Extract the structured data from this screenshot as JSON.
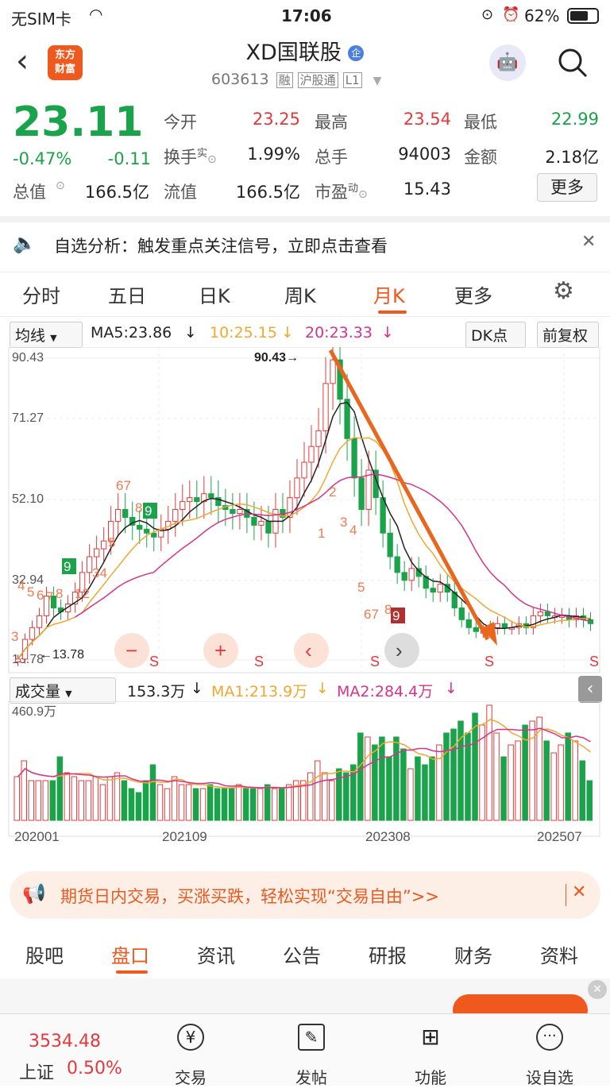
{
  "status": {
    "carrier": "无SIM卡",
    "time": "17:06",
    "battery": "62%"
  },
  "header": {
    "brand_line1": "东方",
    "brand_line2": "财富",
    "title": "XD国联股",
    "badge": "企",
    "code": "603613",
    "tag_margin": "融",
    "tag_connect": "沪股通",
    "tag_level": "L1"
  },
  "quote": {
    "price": "23.11",
    "change_pct": "-0.47%",
    "change": "-0.11",
    "open_label": "今开",
    "open": "23.25",
    "high_label": "最高",
    "high": "23.54",
    "low_label": "最低",
    "low": "22.99",
    "turnover_label": "换手",
    "turnover_sup": "实",
    "turnover": "1.99%",
    "volume_label": "总手",
    "volume": "94003",
    "amount_label": "金额",
    "amount": "2.18亿",
    "mktcap_label": "总值",
    "mktcap": "166.5亿",
    "float_label": "流值",
    "float": "166.5亿",
    "pe_label": "市盈",
    "pe_sup": "动",
    "pe": "15.43",
    "more_button": "更多"
  },
  "notice": {
    "text": "自选分析：触发重点关注信号，立即点击查看"
  },
  "tabs": [
    "分时",
    "五日",
    "日K",
    "周K",
    "月K",
    "更多"
  ],
  "active_tab": "月K",
  "kline_legend": {
    "selector": "均线",
    "ma5": "MA5:23.86",
    "ma10": "10:25.15",
    "ma20": "20:23.33",
    "dk": "DK点",
    "adjust": "前复权"
  },
  "vol_legend": {
    "selector": "成交量",
    "vol": "153.3万",
    "ma1": "MA1:213.9万",
    "ma2": "MA2:284.4万"
  },
  "colors": {
    "up": "#e4393c",
    "down": "#1aa34a",
    "ma5": "#222222",
    "ma10": "#f0a830",
    "ma20": "#d6338a",
    "accent": "#f0591e"
  },
  "chart_data": {
    "type": "candlestick",
    "price_axis": [
      "90.43",
      "71.27",
      "52.10",
      "32.94",
      "13.78"
    ],
    "max_label": "90.43",
    "min_label": "13.78",
    "vol_axis_top": "460.9万",
    "x_ticks": [
      "202001",
      "202109",
      "202308",
      "202507"
    ],
    "signals": [
      "3",
      "4",
      "5",
      "6",
      "7",
      "8",
      "9",
      "12",
      "34",
      "5",
      "67",
      "8",
      "9",
      "1",
      "2",
      "3",
      "4",
      "5",
      "67",
      "8",
      "9"
    ],
    "s_labels": [
      "S",
      "S",
      "S",
      "S",
      "S",
      "S"
    ]
  },
  "ad": {
    "text": "期货日内交易，买涨买跌，轻松实现“交易自由”>>"
  },
  "bottom_tabs": [
    "股吧",
    "盘口",
    "资讯",
    "公告",
    "研报",
    "财务",
    "资料"
  ],
  "active_bottom_tab": "盘口",
  "toolbar": {
    "index_value": "3534.48",
    "index_name": "上证",
    "index_pct": "0.50%",
    "trade": "交易",
    "post": "发帖",
    "func": "功能",
    "watch": "设自选"
  }
}
